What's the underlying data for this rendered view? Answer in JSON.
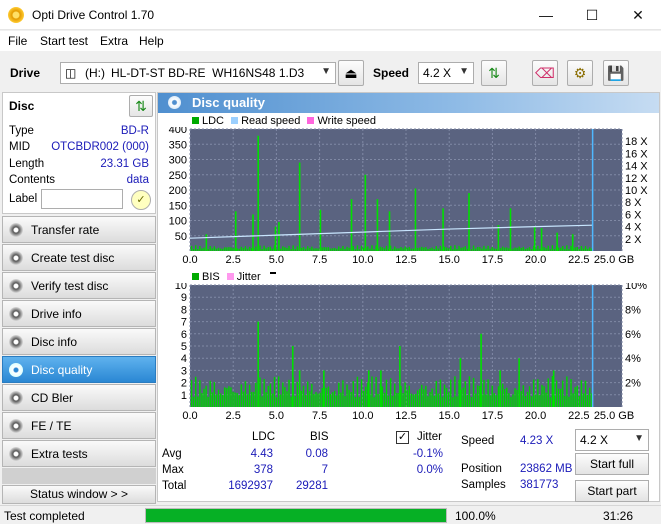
{
  "window": {
    "title": "Opti Drive Control 1.70"
  },
  "menu": [
    "File",
    "Start test",
    "Extra",
    "Help"
  ],
  "drivebar": {
    "drive_label": "Drive",
    "drive_letter": "(H:)",
    "drive_name": "HL-DT-ST BD-RE  WH16NS48 1.D3",
    "speed_label": "Speed",
    "speed_value": "4.2 X"
  },
  "disc": {
    "header": "Disc",
    "rows": [
      {
        "k": "Type",
        "v": "BD-R"
      },
      {
        "k": "MID",
        "v": "OTCBDR002 (000)"
      },
      {
        "k": "Length",
        "v": "23.31 GB"
      },
      {
        "k": "Contents",
        "v": "data"
      }
    ],
    "label_key": "Label",
    "label_value": ""
  },
  "nav": [
    {
      "label": "Transfer rate",
      "active": false
    },
    {
      "label": "Create test disc",
      "active": false
    },
    {
      "label": "Verify test disc",
      "active": false
    },
    {
      "label": "Drive info",
      "active": false
    },
    {
      "label": "Disc info",
      "active": false
    },
    {
      "label": "Disc quality",
      "active": true
    },
    {
      "label": "CD Bler",
      "active": false
    },
    {
      "label": "FE / TE",
      "active": false
    },
    {
      "label": "Extra tests",
      "active": false
    }
  ],
  "status_window_btn": "Status window > >",
  "panel_title": "Disc quality",
  "chart_data": [
    {
      "type": "bar",
      "legend": [
        "LDC",
        "Read speed",
        "Write speed"
      ],
      "colors": {
        "LDC": "#00cc00",
        "Read speed": "#9cd0ff",
        "Write speed": "#ff66dd"
      },
      "x_ticks": [
        "0.0",
        "2.5",
        "5.0",
        "7.5",
        "10.0",
        "12.5",
        "15.0",
        "17.5",
        "20.0",
        "22.5",
        "25.0 GB"
      ],
      "y_left_ticks": [
        "400",
        "350",
        "300",
        "250",
        "200",
        "150",
        "100",
        "50"
      ],
      "y_right_ticks": [
        "18 X",
        "16 X",
        "14 X",
        "12 X",
        "10 X",
        "8 X",
        "6 X",
        "4 X",
        "2 X"
      ],
      "xlim": [
        0,
        25
      ],
      "ylim": [
        0,
        400
      ],
      "ldc_baseline": 12,
      "ldc_spikes": [
        [
          0.9,
          55
        ],
        [
          2.6,
          130
        ],
        [
          3.6,
          120
        ],
        [
          3.9,
          378
        ],
        [
          4.9,
          80
        ],
        [
          5.1,
          95
        ],
        [
          6.3,
          290
        ],
        [
          7.5,
          135
        ],
        [
          9.3,
          170
        ],
        [
          10.1,
          250
        ],
        [
          10.8,
          170
        ],
        [
          11.5,
          130
        ],
        [
          13.0,
          205
        ],
        [
          14.6,
          140
        ],
        [
          16.1,
          190
        ],
        [
          17.8,
          85
        ],
        [
          18.5,
          140
        ],
        [
          19.9,
          80
        ],
        [
          20.3,
          75
        ],
        [
          21.2,
          60
        ],
        [
          22.1,
          55
        ]
      ],
      "read_speed": [
        [
          0,
          2.1
        ],
        [
          5,
          2.6
        ],
        [
          10,
          3.1
        ],
        [
          15,
          3.6
        ],
        [
          20,
          4.0
        ],
        [
          23.3,
          4.23
        ]
      ],
      "end_marker_x": 23.3
    },
    {
      "type": "bar",
      "legend": [
        "BIS",
        "Jitter"
      ],
      "colors": {
        "BIS": "#00cc00",
        "Jitter": "#ff99ee"
      },
      "x_ticks": [
        "0.0",
        "2.5",
        "5.0",
        "7.5",
        "10.0",
        "12.5",
        "15.0",
        "17.5",
        "20.0",
        "22.5",
        "25.0 GB"
      ],
      "y_left_ticks": [
        "10",
        "9",
        "8",
        "7",
        "6",
        "5",
        "4",
        "3",
        "2",
        "1"
      ],
      "y_right_ticks": [
        "10%",
        "8%",
        "6%",
        "4%",
        "2%"
      ],
      "xlim": [
        0,
        25
      ],
      "ylim": [
        0,
        10
      ],
      "bis_baseline": 1,
      "bis_spikes": [
        [
          3.9,
          7
        ],
        [
          5.9,
          5
        ],
        [
          6.3,
          3
        ],
        [
          7.7,
          3
        ],
        [
          10.3,
          3
        ],
        [
          11.0,
          3
        ],
        [
          12.1,
          5
        ],
        [
          15.6,
          4
        ],
        [
          16.8,
          6
        ],
        [
          17.9,
          3
        ],
        [
          19.0,
          4
        ],
        [
          21.0,
          3
        ]
      ],
      "end_marker_x": 23.3
    }
  ],
  "stats": {
    "col_ldc": "LDC",
    "col_bis": "BIS",
    "rows": [
      {
        "k": "Avg",
        "ldc": "4.43",
        "bis": "0.08",
        "jitter": "-0.1%"
      },
      {
        "k": "Max",
        "ldc": "378",
        "bis": "7",
        "jitter": "0.0%"
      },
      {
        "k": "Total",
        "ldc": "1692937",
        "bis": "29281",
        "jitter": ""
      }
    ],
    "jitter_label": "Jitter",
    "speed_label": "Speed",
    "speed_value": "4.23 X",
    "position_label": "Position",
    "position_value": "23862 MB",
    "samples_label": "Samples",
    "samples_value": "381773",
    "speed_select": "4.2 X",
    "start_full": "Start full",
    "start_part": "Start part"
  },
  "status": {
    "text": "Test completed",
    "progress": 100,
    "percent": "100.0%",
    "time": "31:26"
  }
}
